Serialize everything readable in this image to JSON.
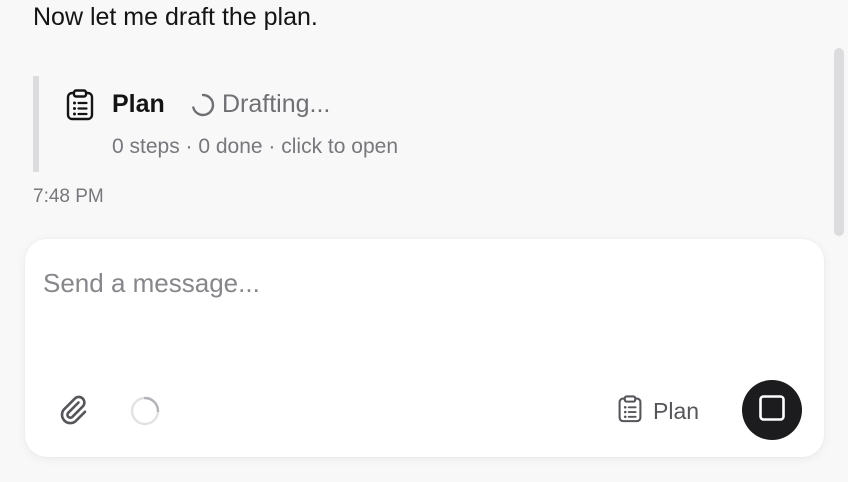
{
  "conversation": {
    "assistant_message": "Now let me draft the plan.",
    "timestamp": "7:48 PM"
  },
  "plan_card": {
    "title": "Plan",
    "status": "Drafting...",
    "meta": "0 steps · 0 done · click to open",
    "icon": "clipboard-list-icon",
    "status_icon": "spinner-icon"
  },
  "composer": {
    "placeholder": "Send a message...",
    "value": "",
    "attach_icon": "paperclip-icon",
    "loading_icon": "loading-ring-icon",
    "plan_toggle_label": "Plan",
    "plan_toggle_icon": "clipboard-list-icon",
    "stop_icon": "stop-square-icon"
  },
  "colors": {
    "background": "#f8f8f9",
    "card_border": "#dcdcdf",
    "stop_button": "#1c1c1e",
    "muted_text": "#77777c"
  }
}
